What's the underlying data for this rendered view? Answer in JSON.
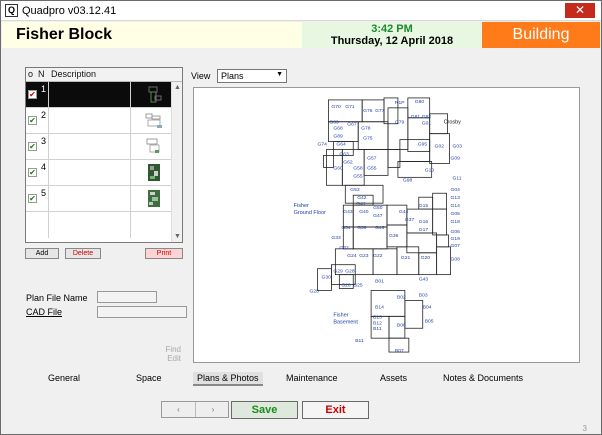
{
  "window": {
    "title": "Quadpro v03.12.41",
    "close_glyph": "✕",
    "app_icon_glyph": "Q"
  },
  "header": {
    "title": "Fisher Block",
    "time": "3:42 PM",
    "date": "Thursday, 12 April 2018",
    "module": "Building",
    "colors": {
      "module_bg": "#ff7b1a",
      "time_color": "#1a8a2e",
      "title_bg": "#ffffe6"
    }
  },
  "grid": {
    "columns": [
      "o",
      "N",
      "Description"
    ],
    "rows": [
      {
        "num": "1",
        "checked": "✔",
        "selected": true
      },
      {
        "num": "2",
        "checked": "✔",
        "selected": false
      },
      {
        "num": "3",
        "checked": "✔",
        "selected": false
      },
      {
        "num": "4",
        "checked": "✔",
        "selected": false
      },
      {
        "num": "5",
        "checked": "✔",
        "selected": false
      }
    ]
  },
  "buttons": {
    "add": "Add",
    "delete": "Delete",
    "print": "Print",
    "save": "Save",
    "exit": "Exit"
  },
  "fields": {
    "plan_file_label": "Plan File Name",
    "cad_file_label": "CAD File",
    "find": "Find",
    "edit": "Edit"
  },
  "view": {
    "label": "View",
    "selected": "Plans"
  },
  "plan_labels": {
    "fisher_ground": "Fisher\nGround Floor",
    "fisher_basement": "Fisher\nBasement",
    "crosby": "Crosby"
  },
  "tabs": [
    "General",
    "Space",
    "Plans & Photos",
    "Maintenance",
    "Assets",
    "Notes & Documents"
  ],
  "active_tab": "Plans & Photos",
  "footer": {
    "prev_icon": "‹",
    "next_icon": "›",
    "page": "3"
  },
  "icons": [
    "close-icon",
    "app-icon",
    "dropdown-arrow-icon",
    "scroll-up-icon",
    "scroll-down-icon",
    "prev-record-icon",
    "next-record-icon"
  ]
}
